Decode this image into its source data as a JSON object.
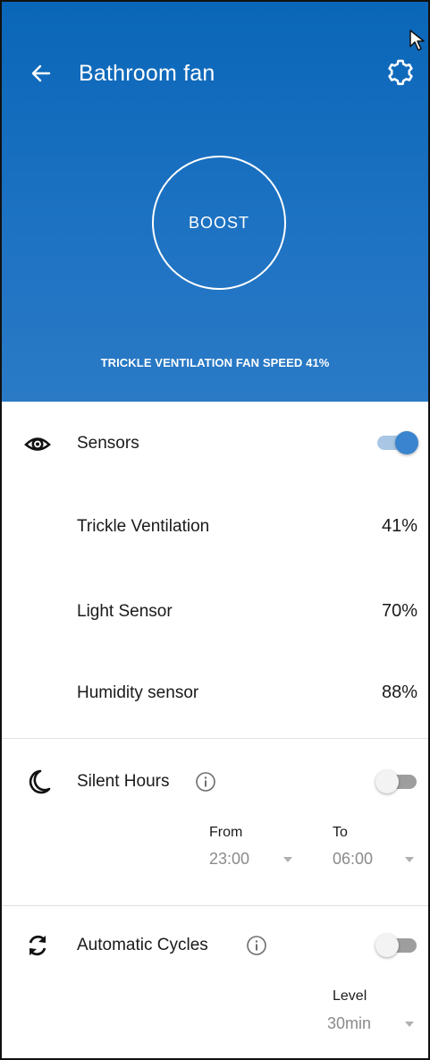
{
  "header": {
    "title": "Bathroom fan",
    "back_icon": "arrow-left-icon",
    "settings_icon": "gear-icon",
    "background_color": "#0a66b8"
  },
  "hero": {
    "boost_label": "BOOST",
    "caption": "TRICKLE VENTILATION FAN SPEED 41%"
  },
  "sensors": {
    "icon": "eye-icon",
    "title": "Sensors",
    "enabled": true,
    "items": [
      {
        "label": "Trickle Ventilation",
        "value": "41%"
      },
      {
        "label": "Light Sensor",
        "value": "70%"
      },
      {
        "label": "Humidity sensor",
        "value": "88%"
      }
    ]
  },
  "silent_hours": {
    "icon": "moon-icon",
    "title": "Silent Hours",
    "enabled": false,
    "from_label": "From",
    "from_value": "23:00",
    "to_label": "To",
    "to_value": "06:00"
  },
  "automatic_cycles": {
    "icon": "refresh-icon",
    "title": "Automatic Cycles",
    "enabled": false,
    "level_label": "Level",
    "level_value": "30min"
  },
  "colors": {
    "accent": "#3a84cf",
    "toggle_on_track": "#a9c7e4",
    "toggle_off_track": "#9e9e9e"
  }
}
